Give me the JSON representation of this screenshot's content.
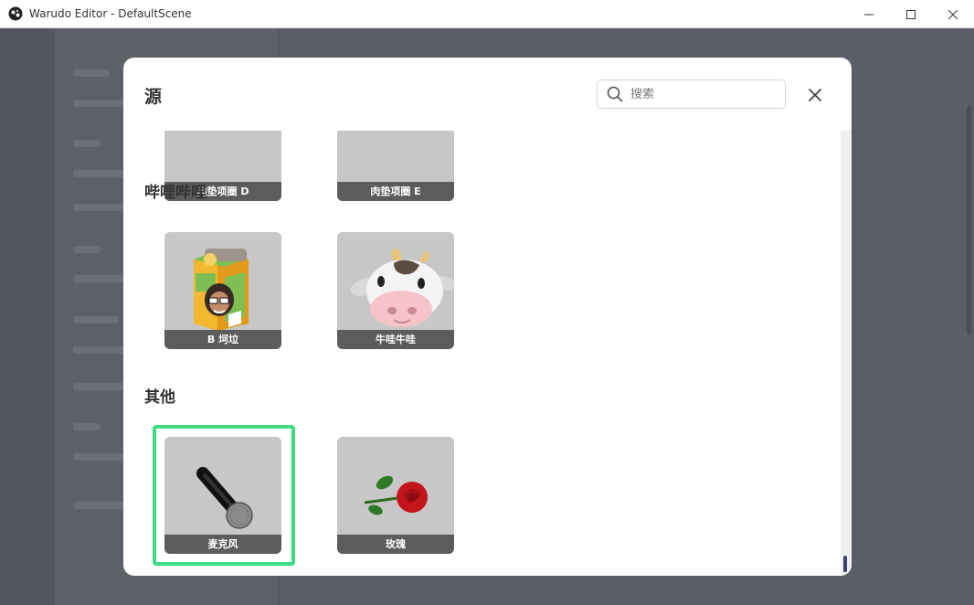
{
  "window": {
    "title": "Warudo Editor - DefaultScene",
    "controls": [
      "minimize-icon",
      "maximize-icon",
      "close-icon"
    ]
  },
  "modal": {
    "title": "源",
    "search_placeholder": "搜索",
    "search_value": "",
    "close_icon": "close-icon"
  },
  "sections": [
    {
      "title": "",
      "items": [
        {
          "label": "肉垫项圈 D"
        },
        {
          "label": "肉垫项圈 E"
        }
      ]
    },
    {
      "title": "哔哩哔哩",
      "items": [
        {
          "label": "B 坷垃",
          "icon": "juice-box-character-icon"
        },
        {
          "label": "牛哇牛哇",
          "icon": "cow-icon"
        }
      ]
    },
    {
      "title": "其他",
      "items": [
        {
          "label": "麦克风",
          "icon": "microphone-icon",
          "selected": true
        },
        {
          "label": "玫瑰",
          "icon": "rose-icon"
        }
      ]
    }
  ],
  "colors": {
    "selection": "#3ddc84",
    "card_bg": "#c7c7c7",
    "card_label_bg": "#5c5c5c",
    "scroll_thumb": "#3c3f7a"
  }
}
